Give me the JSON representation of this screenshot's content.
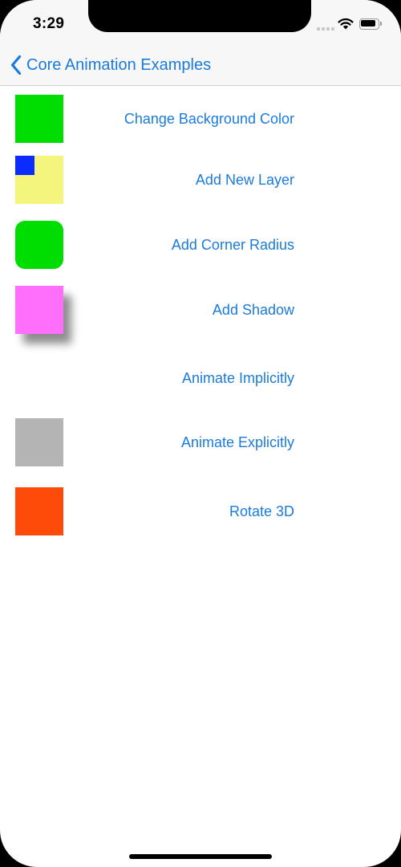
{
  "status_bar": {
    "time": "3:29",
    "icons": [
      "signal-icon",
      "wifi-icon",
      "battery-icon"
    ]
  },
  "nav": {
    "back_icon": "chevron-left-icon",
    "back_label": "Core Animation Examples"
  },
  "colors": {
    "tint": "#1a7bdc",
    "bar_background": "#f7f7f7"
  },
  "rows": [
    {
      "button_label": "Change Background Color",
      "swatch_color": "#00dd00"
    },
    {
      "button_label": "Add New Layer",
      "swatch_color": "#f3f57c",
      "sublayer_color": "#0b2bff"
    },
    {
      "button_label": "Add Corner Radius",
      "swatch_color": "#00dd00"
    },
    {
      "button_label": "Add Shadow",
      "swatch_color": "#ff6ffc"
    },
    {
      "button_label": "Animate Implicitly"
    },
    {
      "button_label": "Animate Explicitly",
      "swatch_color": "#b4b4b4"
    },
    {
      "button_label": "Rotate 3D",
      "swatch_color": "#ff4b0a"
    }
  ]
}
